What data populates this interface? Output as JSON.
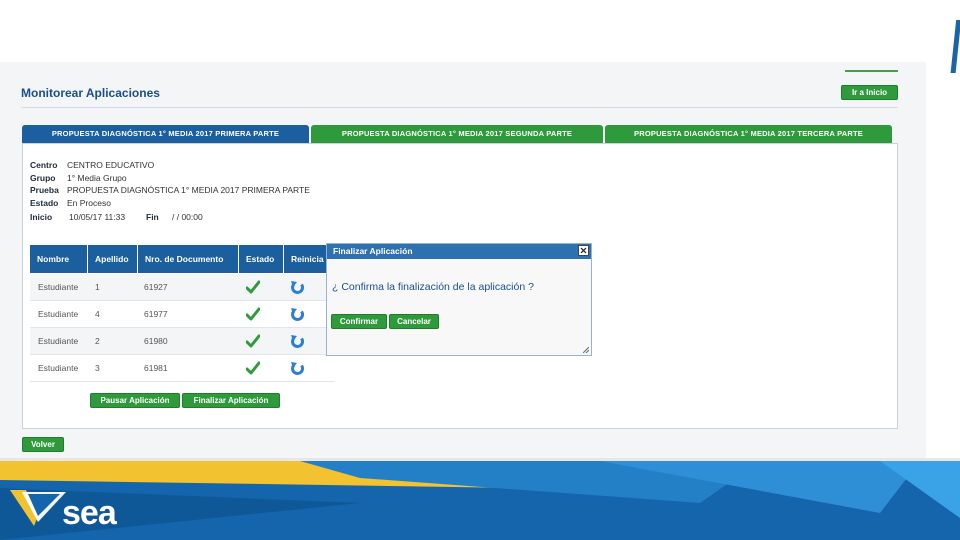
{
  "header": {
    "page_title": "Monitorear Aplicaciones",
    "home_button": "Ir a Inicio"
  },
  "tabs": [
    {
      "label": "PROPUESTA DIAGNÓSTICA 1° MEDIA 2017 PRIMERA PARTE",
      "active": true
    },
    {
      "label": "PROPUESTA DIAGNÓSTICA 1° MEDIA 2017 SEGUNDA PARTE",
      "active": false
    },
    {
      "label": "PROPUESTA DIAGNÓSTICA 1° MEDIA 2017 TERCERA PARTE",
      "active": false
    }
  ],
  "info": {
    "centro_label": "Centro",
    "centro_value": "CENTRO EDUCATIVO",
    "grupo_label": "Grupo",
    "grupo_value": "1° Media   Grupo",
    "prueba_label": "Prueba",
    "prueba_value": "PROPUESTA DIAGNÓSTICA 1° MEDIA 2017 PRIMERA PARTE",
    "estado_label": "Estado",
    "estado_value": "En Proceso",
    "inicio_label": "Inicio",
    "inicio_value": "10/05/17 11:33",
    "fin_label": "Fin",
    "fin_value": "/ / 00:00"
  },
  "table": {
    "columns": [
      "Nombre",
      "Apellido",
      "Nro. de Documento",
      "Estado",
      "Reinicia"
    ],
    "rows": [
      {
        "nombre": "Estudiante",
        "apellido": "1",
        "documento": "61927"
      },
      {
        "nombre": "Estudiante",
        "apellido": "4",
        "documento": "61977"
      },
      {
        "nombre": "Estudiante",
        "apellido": "2",
        "documento": "61980"
      },
      {
        "nombre": "Estudiante",
        "apellido": "3",
        "documento": "61981"
      }
    ]
  },
  "actions": {
    "pause_button": "Pausar Aplicación",
    "finish_button": "Finalizar Aplicación",
    "back_button": "Volver"
  },
  "dialog": {
    "title": "Finalizar Aplicación",
    "message": "¿ Confirma la finalización de la aplicación ?",
    "confirm_button": "Confirmar",
    "cancel_button": "Cancelar"
  },
  "brand": {
    "logo_text": "sea"
  },
  "colors": {
    "primary_blue": "#1b5f9e",
    "accent_green": "#2f9a3c",
    "band_blue": "#1565ad",
    "band_yellow": "#f2c230"
  },
  "icons": {
    "estado": "check-icon",
    "reinicia": "reset-icon",
    "dialog_close": "close-icon"
  }
}
